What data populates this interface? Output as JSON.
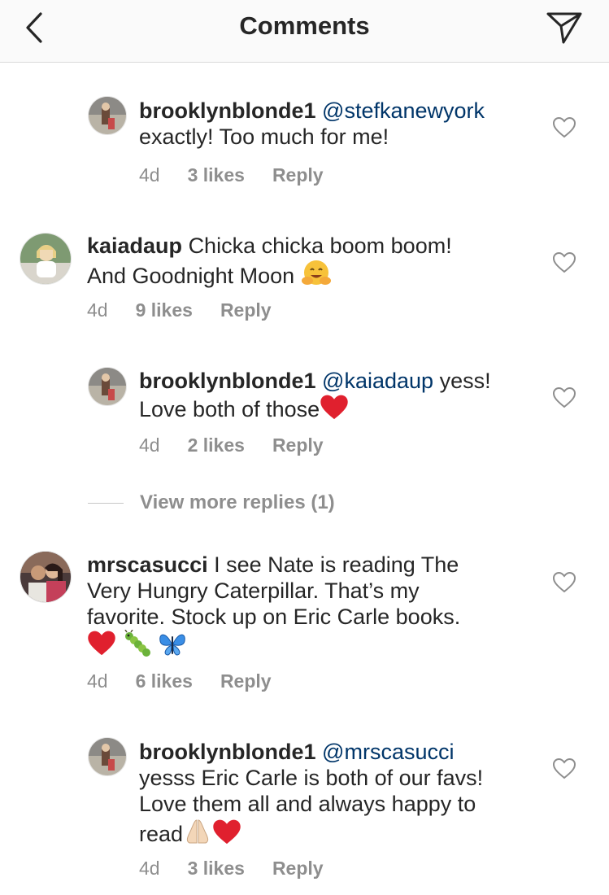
{
  "header": {
    "title": "Comments",
    "back_icon": "chevron-left-icon",
    "send_icon": "paper-plane-icon"
  },
  "comments": [
    {
      "username": "brooklynblonde1",
      "mention": "@stefkanewyork",
      "text_after_mention": "",
      "line1": "",
      "line2": "exactly! Too much for me!",
      "time": "4d",
      "likes": "3 likes",
      "reply": "Reply"
    },
    {
      "username": "kaiadaup",
      "line1": "Chicka chicka boom boom!",
      "line2": "And Goodnight Moon",
      "emoji": "hugging-face",
      "time": "4d",
      "likes": "9 likes",
      "reply": "Reply"
    },
    {
      "username": "brooklynblonde1",
      "mention": "@kaiadaup",
      "line1": "yess!",
      "line2": "Love both of those",
      "emoji": "red-heart",
      "time": "4d",
      "likes": "2 likes",
      "reply": "Reply"
    },
    {
      "username": "mrscasucci",
      "line1": "I see Nate is reading The",
      "line2": "Very Hungry Caterpillar. That’s my",
      "line3": "favorite. Stock up on Eric Carle books.",
      "emojis": [
        "red-heart",
        "caterpillar",
        "butterfly"
      ],
      "time": "4d",
      "likes": "6 likes",
      "reply": "Reply"
    },
    {
      "username": "brooklynblonde1",
      "mention": "@mrscasucci",
      "line1": "yesss Eric Carle is both of our favs!",
      "line2": "Love them all and always happy to",
      "line3": "read",
      "emojis": [
        "folded-hands",
        "red-heart"
      ],
      "time": "4d",
      "likes": "3 likes",
      "reply": "Reply"
    }
  ],
  "view_more": "View more replies (1)",
  "colors": {
    "text": "#262626",
    "mention": "#003569",
    "meta": "#8e8e8e",
    "header_bg": "#fafafa",
    "divider": "#dbdbdb"
  }
}
